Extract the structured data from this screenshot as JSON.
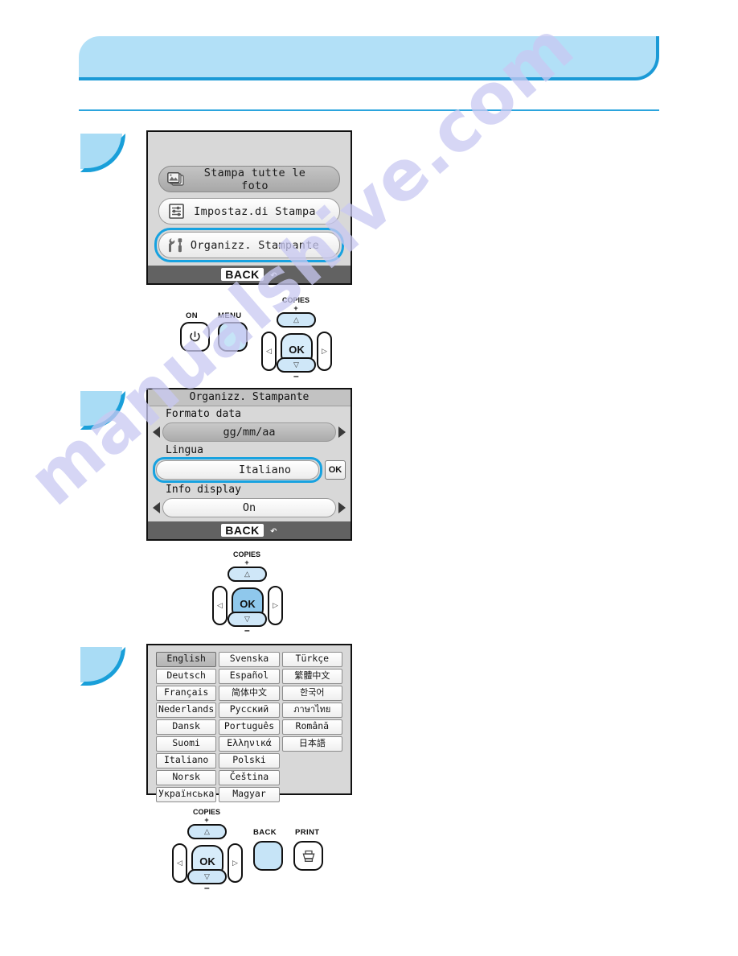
{
  "watermark": {
    "text": "manualshive.com"
  },
  "header": {
    "title": ""
  },
  "steps": [
    {
      "number": ""
    },
    {
      "number": ""
    },
    {
      "number": ""
    }
  ],
  "lcd_menu": {
    "items": [
      {
        "label": "Stampa tutte le foto",
        "icon": "photos-icon",
        "state": "grey"
      },
      {
        "label": "Impostaz.di Stampa",
        "icon": "print-settings-icon",
        "state": "plain"
      },
      {
        "label": "Organizz. Stampante",
        "icon": "tools-icon",
        "state": "highlighted"
      }
    ],
    "footer": {
      "back_label": "BACK",
      "back_glyph": "↶"
    }
  },
  "lcd_settings": {
    "title": "Organizz. Stampante",
    "rows": [
      {
        "name": "Formato data",
        "value": "gg/mm/aa",
        "style": "grey",
        "arrows": true
      },
      {
        "name": "Lingua",
        "value": "Italiano",
        "style": "white",
        "arrows": false,
        "ok_label": "OK",
        "highlighted": true
      },
      {
        "name": "Info display",
        "value": "On",
        "style": "white",
        "arrows": true
      }
    ],
    "footer": {
      "back_label": "BACK",
      "back_glyph": "↶"
    }
  },
  "lcd_languages": {
    "cells": [
      {
        "label": "English",
        "selected": true,
        "script": "latin"
      },
      {
        "label": "Svenska",
        "selected": false,
        "script": "latin"
      },
      {
        "label": "Türkçe",
        "selected": false,
        "script": "latin"
      },
      {
        "label": "Deutsch",
        "selected": false,
        "script": "latin"
      },
      {
        "label": "Español",
        "selected": false,
        "script": "latin"
      },
      {
        "label": "繁體中文",
        "selected": false,
        "script": "cjk"
      },
      {
        "label": "Français",
        "selected": false,
        "script": "latin"
      },
      {
        "label": "简体中文",
        "selected": false,
        "script": "cjk"
      },
      {
        "label": "한국어",
        "selected": false,
        "script": "cjk"
      },
      {
        "label": "Nederlands",
        "selected": false,
        "script": "latin"
      },
      {
        "label": "Русский",
        "selected": false,
        "script": "latin"
      },
      {
        "label": "ภาษาไทย",
        "selected": false,
        "script": "cjk"
      },
      {
        "label": "Dansk",
        "selected": false,
        "script": "latin"
      },
      {
        "label": "Português",
        "selected": false,
        "script": "latin"
      },
      {
        "label": "Română",
        "selected": false,
        "script": "latin"
      },
      {
        "label": "Suomi",
        "selected": false,
        "script": "latin"
      },
      {
        "label": "Ελληνικά",
        "selected": false,
        "script": "latin"
      },
      {
        "label": "日本語",
        "selected": false,
        "script": "cjk"
      },
      {
        "label": "Italiano",
        "selected": false,
        "script": "latin"
      },
      {
        "label": "Polski",
        "selected": false,
        "script": "latin"
      },
      {
        "label": "",
        "selected": false,
        "script": "empty"
      },
      {
        "label": "Norsk",
        "selected": false,
        "script": "latin"
      },
      {
        "label": "Čeština",
        "selected": false,
        "script": "latin"
      },
      {
        "label": "",
        "selected": false,
        "script": "empty"
      },
      {
        "label": "Українська",
        "selected": false,
        "script": "latin"
      },
      {
        "label": "Magyar",
        "selected": false,
        "script": "latin"
      },
      {
        "label": "",
        "selected": false,
        "script": "empty"
      }
    ]
  },
  "button_diagrams": [
    {
      "id": "diagram-menu",
      "buttons": [
        {
          "name": "on-button",
          "label": "ON",
          "glyph": "⏻",
          "highlighted": false
        },
        {
          "name": "menu-button",
          "label": "MENU",
          "glyph": "",
          "highlighted": true
        }
      ],
      "nav": {
        "copies_label": "COPIES",
        "plus_label": "+",
        "minus_label": "–",
        "up_glyph": "△",
        "down_glyph": "▽",
        "left_glyph": "◁",
        "right_glyph": "▷",
        "ok_label": "OK",
        "ok_highlighted": false
      }
    },
    {
      "id": "diagram-ok",
      "buttons": [],
      "nav": {
        "copies_label": "COPIES",
        "plus_label": "+",
        "minus_label": "–",
        "up_glyph": "△",
        "down_glyph": "▽",
        "left_glyph": "◁",
        "right_glyph": "▷",
        "ok_label": "OK",
        "ok_highlighted": true
      }
    },
    {
      "id": "diagram-back-print",
      "buttons": [
        {
          "name": "back-button",
          "label": "BACK",
          "glyph": "",
          "highlighted": true
        },
        {
          "name": "print-button",
          "label": "PRINT",
          "glyph": "printer",
          "highlighted": false
        }
      ],
      "nav": {
        "copies_label": "COPIES",
        "plus_label": "+",
        "minus_label": "–",
        "up_glyph": "△",
        "down_glyph": "▽",
        "left_glyph": "◁",
        "right_glyph": "▷",
        "ok_label": "OK",
        "ok_highlighted": false
      }
    }
  ],
  "colors": {
    "accent_blue": "#17a2e0",
    "banner_blue": "#b2e0f7",
    "button_blue": "#cfe7f8",
    "watermark": "#c9c9f2"
  }
}
